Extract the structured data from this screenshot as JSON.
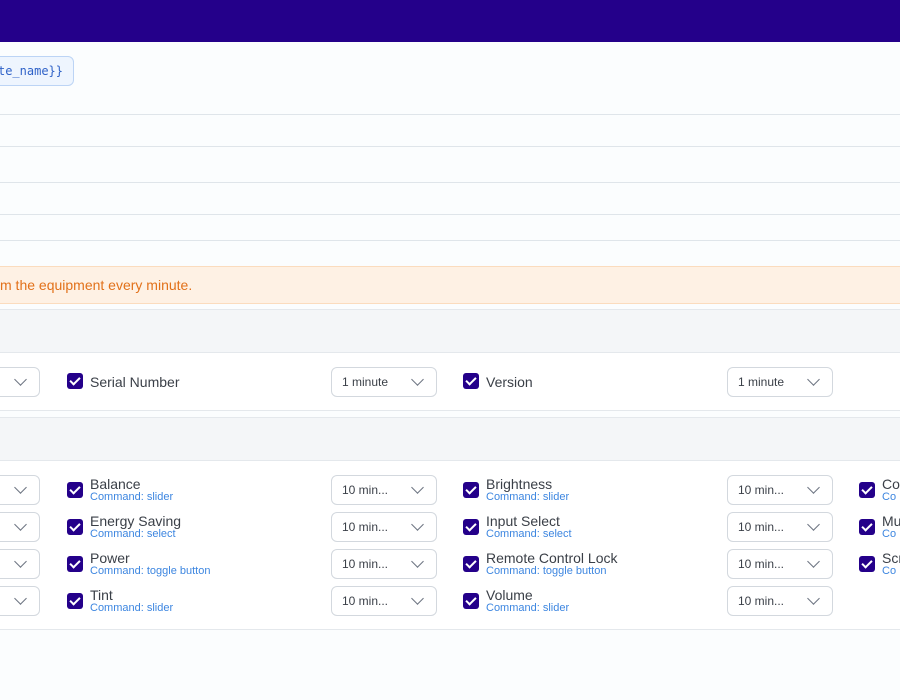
{
  "template_chip": "te_name}}",
  "banner": {
    "text": "m the equipment every minute."
  },
  "status_row": {
    "left_select": "",
    "items": [
      {
        "label": "Serial Number",
        "interval": "1 minute"
      },
      {
        "label": "Version",
        "interval": "1 minute"
      }
    ]
  },
  "command_rows": [
    {
      "left_select": "",
      "items": [
        {
          "label": "Balance",
          "sub": "Command: slider",
          "interval": "10 min..."
        },
        {
          "label": "Brightness",
          "sub": "Command: slider",
          "interval": "10 min..."
        },
        {
          "label": "Co",
          "sub": "Co"
        }
      ]
    },
    {
      "left_select": "",
      "items": [
        {
          "label": "Energy Saving",
          "sub": "Command: select",
          "interval": "10 min..."
        },
        {
          "label": "Input Select",
          "sub": "Command: select",
          "interval": "10 min..."
        },
        {
          "label": "Mu",
          "sub": "Co"
        }
      ]
    },
    {
      "left_select": "",
      "items": [
        {
          "label": "Power",
          "sub": "Command: toggle button",
          "interval": "10 min..."
        },
        {
          "label": "Remote Control Lock",
          "sub": "Command: toggle button",
          "interval": "10 min..."
        },
        {
          "label": "Scr",
          "sub": "Co"
        }
      ]
    },
    {
      "left_select": "",
      "items": [
        {
          "label": "Tint",
          "sub": "Command: slider",
          "interval": "10 min..."
        },
        {
          "label": "Volume",
          "sub": "Command: slider",
          "interval": "10 min..."
        }
      ]
    }
  ],
  "colors": {
    "brand": "#24008a",
    "warning_text": "#e2711a",
    "warning_bg": "#fef1e4",
    "link": "#3d86e0"
  }
}
